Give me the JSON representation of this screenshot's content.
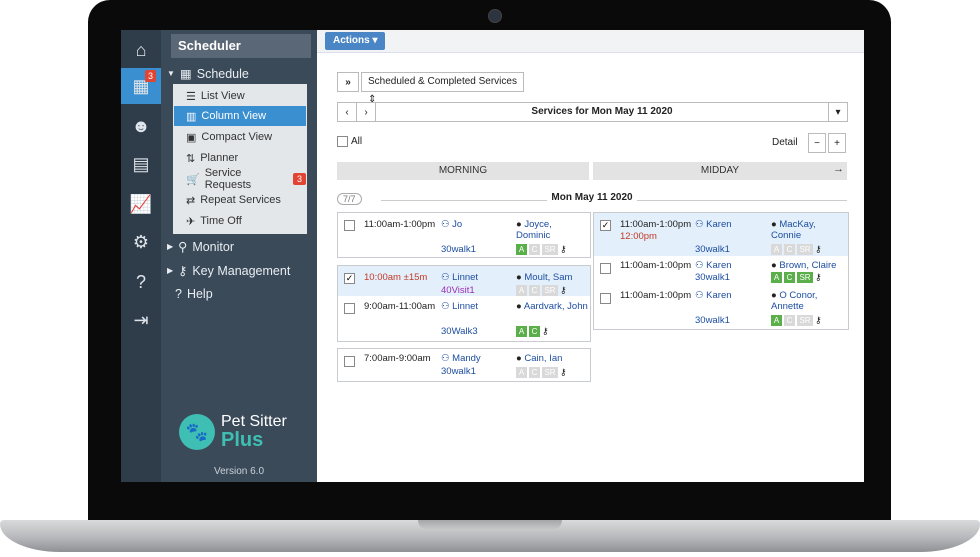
{
  "nav": {
    "title": "Scheduler",
    "schedule_label": "Schedule",
    "schedule_badge": "3",
    "submenu": [
      {
        "label": "List View",
        "icon": "list-icon"
      },
      {
        "label": "Column View",
        "icon": "columns-icon",
        "selected": true
      },
      {
        "label": "Compact View",
        "icon": "compact-icon"
      },
      {
        "label": "Planner",
        "icon": "sort-icon"
      },
      {
        "label": "Service Requests",
        "icon": "cart-icon",
        "badge": "3"
      },
      {
        "label": "Repeat Services",
        "icon": "repeat-icon"
      },
      {
        "label": "Time Off",
        "icon": "plane-icon"
      }
    ],
    "monitor_label": "Monitor",
    "key_management_label": "Key Management",
    "help_label": "Help",
    "logo_line1": "Pet Sitter",
    "logo_line2": "Plus",
    "version": "Version 6.0"
  },
  "toolbar": {
    "actions_label": "Actions ▾"
  },
  "controls": {
    "expand_label": "»",
    "service_filter": "Scheduled & Completed Services",
    "prev_label": "‹",
    "next_label": "›",
    "date_title": "Services for Mon May 11 2020",
    "all_label": "All",
    "detail_label": "Detail",
    "minus_label": "−",
    "plus_label": "+"
  },
  "columns": {
    "morning": "MORNING",
    "midday": "MIDDAY"
  },
  "date_header": "Mon May 11 2020",
  "count_pill": "7/7",
  "morning_cards": [
    {
      "rows": [
        {
          "time": "11:00am-1:00pm",
          "sitter": "Jo",
          "client": "Joyce, Dominic",
          "service": "30walk1",
          "checked": false,
          "tags": [
            "A",
            "C",
            "SR"
          ],
          "tag_on": [
            true,
            false,
            false
          ]
        }
      ]
    },
    {
      "rows": [
        {
          "time": "10:00am ±15m",
          "sitter": "Linnet",
          "client": "Moult, Sam",
          "service": "40Visit1",
          "checked": true,
          "tags": [
            "A",
            "C",
            "SR"
          ],
          "tag_on": [
            false,
            false,
            false
          ]
        },
        {
          "time": "9:00am-11:00am",
          "sitter": "Linnet",
          "client": "Aardvark, John",
          "service": "30Walk3",
          "checked": false,
          "tags": [
            "A",
            "C",
            "SR"
          ],
          "tag_on": [
            true,
            true,
            false
          ]
        }
      ]
    },
    {
      "rows": [
        {
          "time": "7:00am-9:00am",
          "sitter": "Mandy",
          "client": "Cain, Ian",
          "service": "30walk1",
          "checked": false,
          "tags": [
            "A",
            "C",
            "SR"
          ],
          "tag_on": [
            false,
            false,
            false
          ]
        }
      ]
    }
  ],
  "midday_card": {
    "rows": [
      {
        "time": "11:00am-1:00pm",
        "time2": "12:00pm",
        "sitter": "Karen",
        "client": "MacKay, Connie",
        "service": "30walk1",
        "checked": true,
        "tags": [
          "A",
          "C",
          "SR"
        ],
        "tag_on": [
          false,
          false,
          false
        ]
      },
      {
        "time": "11:00am-1:00pm",
        "sitter": "Karen",
        "client": "Brown, Claire",
        "service": "30walk1",
        "checked": false,
        "tags": [
          "A",
          "C",
          "SR"
        ],
        "tag_on": [
          true,
          true,
          true
        ]
      },
      {
        "time": "11:00am-1:00pm",
        "sitter": "Karen",
        "client": "O Conor, Annette",
        "service": "30walk1",
        "checked": false,
        "tags": [
          "A",
          "C",
          "SR"
        ],
        "tag_on": [
          true,
          false,
          false
        ]
      }
    ]
  }
}
